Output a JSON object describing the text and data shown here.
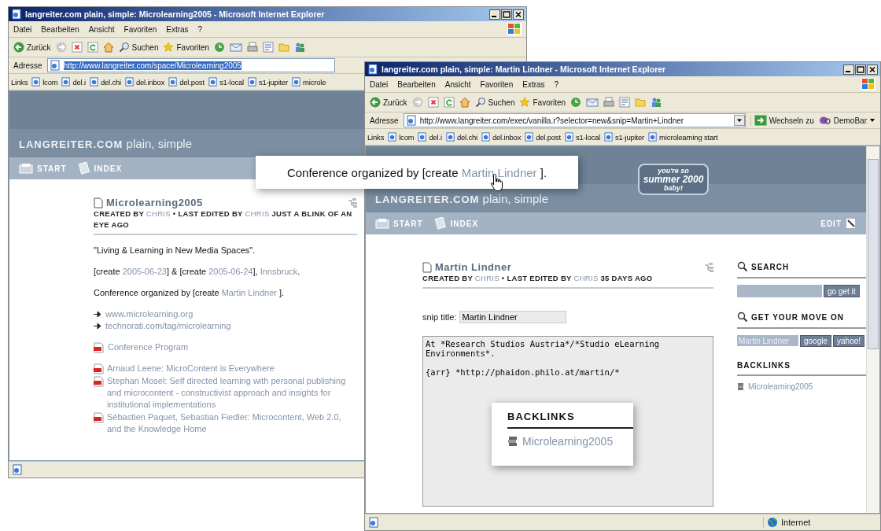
{
  "windows": [
    {
      "title": "langreiter.com plain, simple: Microlearning2005 - Microsoft Internet Explorer",
      "menu": [
        "Datei",
        "Bearbeiten",
        "Ansicht",
        "Favoriten",
        "Extras",
        "?"
      ],
      "toolbar": [
        "Zurück",
        "Suchen",
        "Favoriten"
      ],
      "address_label": "Adresse",
      "url": "http://www.langreiter.com/space/Microlearning2005",
      "url_selected": true,
      "links_label": "Links",
      "links": [
        "lcom",
        "del.i",
        "del.chi",
        "del.inbox",
        "del.post",
        "s1-local",
        "s1-jupiter",
        "microle"
      ],
      "site_name": "LANGREITER.COM",
      "site_tagline": "plain, simple",
      "nav": [
        "START",
        "INDEX"
      ],
      "page": {
        "kind": "article",
        "title": "Microlearning2005",
        "meta": [
          {
            "text": "CREATED BY ",
            "kind": "text"
          },
          {
            "text": "CHRIS",
            "kind": "link"
          },
          {
            "text": " • LAST EDITED BY ",
            "kind": "text"
          },
          {
            "text": "CHRIS",
            "kind": "link"
          },
          {
            "text": " JUST A BLINK OF AN EYE AGO",
            "kind": "text"
          }
        ],
        "paragraphs": [
          [
            {
              "text": "\"Living & Learning in New Media Spaces\".",
              "kind": "text"
            }
          ],
          [
            {
              "text": "[create ",
              "kind": "text"
            },
            {
              "text": "2005-06-23",
              "kind": "link"
            },
            {
              "text": "] & [create ",
              "kind": "text"
            },
            {
              "text": "2005-06-24",
              "kind": "link"
            },
            {
              "text": "], ",
              "kind": "text"
            },
            {
              "text": "Innsbruck",
              "kind": "link"
            },
            {
              "text": ".",
              "kind": "text"
            }
          ],
          [
            {
              "text": "Conference organized by [create ",
              "kind": "text"
            },
            {
              "text": "Martin Lindner",
              "kind": "link"
            },
            {
              "text": " ].",
              "kind": "text"
            }
          ]
        ],
        "arrow_links": [
          "www.microlearning.org",
          "technorati.com/tag/microlearning"
        ],
        "program": "Conference Program",
        "papers": [
          "Arnaud Leene: MicroContent is Everywhere",
          "Stephan Mosel: Self directed learning with personal publishing and microcontent - constructivist approach and insights for institutional implementations",
          "Sébastien Paquet, Sebastian Fiedler: Microcontent, Web 2.0, and the Knowledge Home"
        ]
      }
    },
    {
      "title": "langreiter.com plain, simple: Martin Lindner - Microsoft Internet Explorer",
      "menu": [
        "Datei",
        "Bearbeiten",
        "Ansicht",
        "Favoriten",
        "Extras",
        "?"
      ],
      "toolbar": [
        "Zurück",
        "Suchen",
        "Favoriten"
      ],
      "address_label": "Adresse",
      "url": "http://www.langreiter.com/exec/vanilla.r?selector=new&snip=Martin+Lindner",
      "url_selected": false,
      "go_label": "Wechseln zu",
      "demobar": "DemoBar",
      "links_label": "Links",
      "links": [
        "lcom",
        "del.i",
        "del.chi",
        "del.inbox",
        "del.post",
        "s1-local",
        "s1-jupiter",
        "microlearning start"
      ],
      "site_name": "LANGREITER.COM",
      "site_tagline": "plain, simple",
      "nav": [
        "START",
        "INDEX"
      ],
      "edit": "EDIT",
      "badge": [
        "you're so",
        "summer 2000",
        "baby!"
      ],
      "status_zone": "Internet",
      "page": {
        "kind": "editor",
        "title": "Martin Lindner",
        "meta": [
          {
            "text": "CREATED BY ",
            "kind": "text"
          },
          {
            "text": "CHRIS",
            "kind": "link"
          },
          {
            "text": " • LAST EDITED BY ",
            "kind": "text"
          },
          {
            "text": "CHRIS",
            "kind": "link"
          },
          {
            "text": " 35 DAYS AGO",
            "kind": "text"
          }
        ],
        "snip_label": "snip title:",
        "snip_value": "Martin Lindner",
        "body": [
          "At *Research Studios Austria*/*Studio eLearning Environments*.",
          "{arr} *http://phaidon.philo.at/martin/*"
        ],
        "search_title": "SEARCH",
        "search_button": "go get it",
        "move_title": "GET YOUR MOVE ON",
        "move_field": "Martin Lindner",
        "move_buttons": [
          "google",
          "yahoo!"
        ],
        "backlinks_title": "BACKLINKS",
        "backlinks": [
          "Microlearning2005"
        ]
      }
    }
  ],
  "callouts": [
    {
      "kind": "sentence",
      "parts": [
        {
          "text": "Conference organized by [create ",
          "kind": "text"
        },
        {
          "text": "Martin Lindner",
          "kind": "link"
        },
        {
          "text": " ].",
          "kind": "text"
        }
      ]
    },
    {
      "kind": "backlinks",
      "title": "BACKLINKS",
      "items": [
        "Microlearning2005"
      ]
    }
  ]
}
